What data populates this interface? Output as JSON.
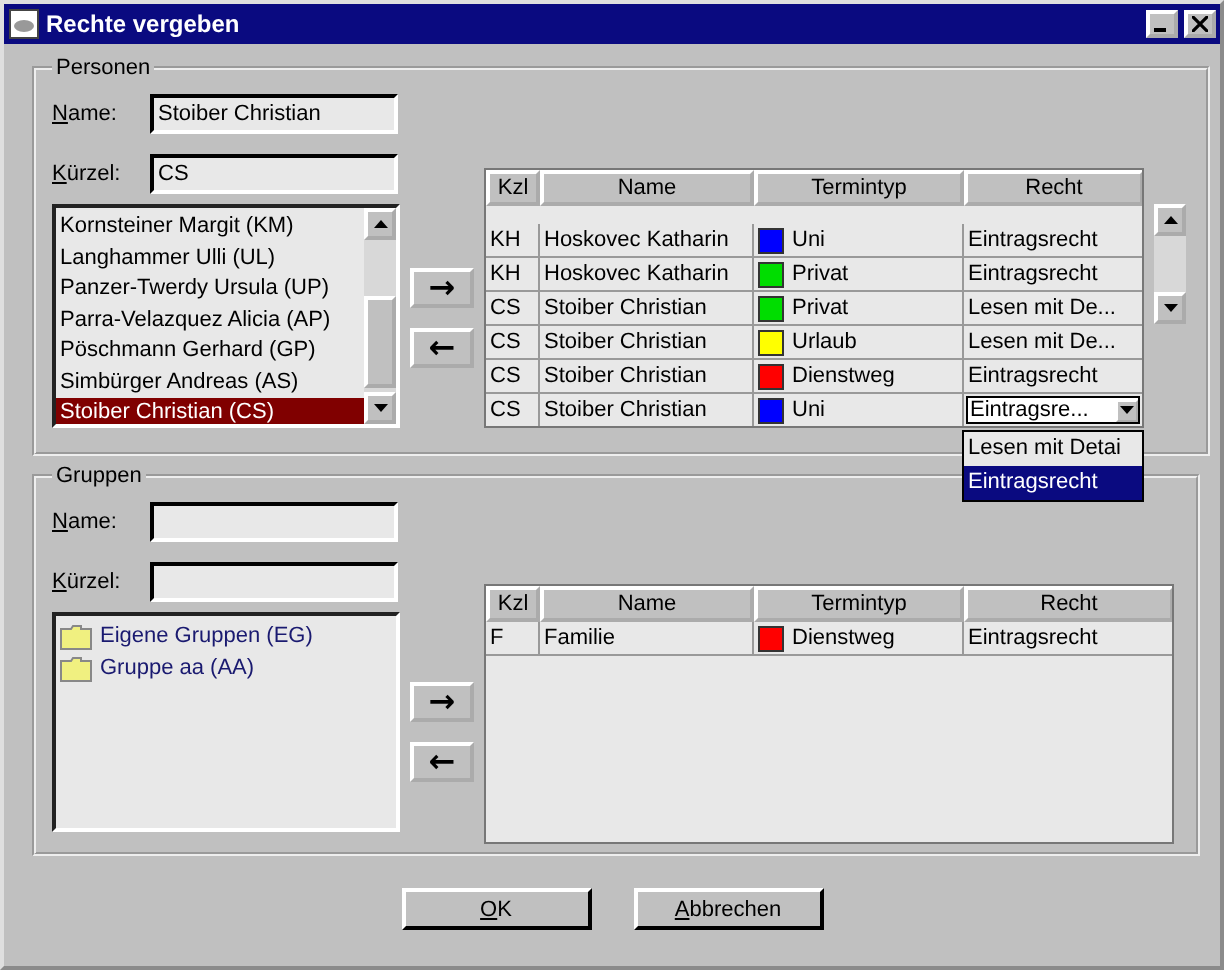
{
  "window": {
    "title": "Rechte vergeben"
  },
  "personen": {
    "title": "Personen",
    "name_label": "Name:",
    "name_value": "Stoiber Christian",
    "kuerzel_label": "Kürzel:",
    "kuerzel_value": "CS",
    "list": [
      {
        "label": "Kornsteiner Margit (KM)",
        "selected": false
      },
      {
        "label": "Langhammer Ulli (UL)",
        "selected": false
      },
      {
        "label": "Panzer-Twerdy Ursula (UP)",
        "selected": false
      },
      {
        "label": "Parra-Velazquez Alicia (AP)",
        "selected": false
      },
      {
        "label": "Pöschmann Gerhard (GP)",
        "selected": false
      },
      {
        "label": "Simbürger Andreas (AS)",
        "selected": false
      },
      {
        "label": "Stoiber Christian (CS)",
        "selected": true
      }
    ],
    "add_button": "→",
    "remove_button": "←",
    "table": {
      "columns": [
        "Kzl",
        "Name",
        "Termintyp",
        "Recht"
      ],
      "rows": [
        {
          "kind": "text",
          "kzl": "KH",
          "name": "Hoskovec Katharin",
          "termintyp": "Uni",
          "color": "#0000ff",
          "recht": "Eintragsrecht"
        },
        {
          "kind": "text",
          "kzl": "KH",
          "name": "Hoskovec Katharin",
          "termintyp": "Privat",
          "color": "#00dd00",
          "recht": "Eintragsrecht"
        },
        {
          "kind": "text",
          "kzl": "CS",
          "name": "Stoiber Christian",
          "termintyp": "Privat",
          "color": "#00dd00",
          "recht": "Lesen mit De..."
        },
        {
          "kind": "text",
          "kzl": "CS",
          "name": "Stoiber Christian",
          "termintyp": "Urlaub",
          "color": "#ffff00",
          "recht": "Lesen mit De..."
        },
        {
          "kind": "text",
          "kzl": "CS",
          "name": "Stoiber Christian",
          "termintyp": "Dienstweg",
          "color": "#ff0000",
          "recht": "Eintragsrecht"
        },
        {
          "kind": "combo",
          "kzl": "CS",
          "name": "Stoiber Christian",
          "termintyp": "Uni",
          "color": "#0000ff",
          "recht": "Eintragsre...",
          "options": [
            {
              "label": "Lesen mit Detai",
              "selected": false
            },
            {
              "label": "Eintragsrecht",
              "selected": true
            }
          ]
        }
      ]
    }
  },
  "gruppen": {
    "title": "Gruppen",
    "name_label": "Name:",
    "kuerzel_label": "Kürzel:",
    "tree": [
      {
        "label": "Eigene Gruppen (EG)"
      },
      {
        "label": "Gruppe aa (AA)"
      }
    ],
    "add_button": "→",
    "remove_button": "←",
    "table": {
      "columns": [
        "Kzl",
        "Name",
        "Termintyp",
        "Recht"
      ],
      "rows": [
        {
          "kind": "text",
          "kzl": "F",
          "name": "Familie",
          "termintyp": "Dienstweg",
          "color": "#ff0000",
          "recht": "Eintragsrecht"
        }
      ]
    }
  },
  "buttons": [
    "OK",
    "Abbrechen"
  ]
}
